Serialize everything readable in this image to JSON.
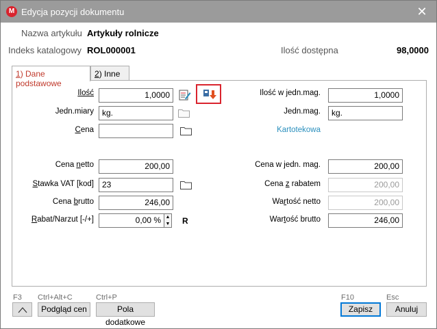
{
  "window": {
    "title": "Edycja pozycji dokumentu",
    "app_icon": "M"
  },
  "header": {
    "name_label": "Nazwa artykułu",
    "name_value": "Artykuły rolnicze",
    "index_label": "Indeks katalogowy",
    "index_value": "ROL000001",
    "qty_label": "Ilość dostępna",
    "qty_value": "98,0000"
  },
  "tabs": [
    {
      "key": "1",
      "label": ") Dane podstawowe"
    },
    {
      "key": "2",
      "label": ") Inne"
    }
  ],
  "left": {
    "qty_label": "Ilość",
    "qty_value": "1,0000",
    "unit_label": "Jedn.miary",
    "unit_value": "kg.",
    "price_label_u": "C",
    "price_label_rest": "ena",
    "price_value": "",
    "net_label_pre": "Cena ",
    "net_label_u": "n",
    "net_label_rest": "etto",
    "net_value": "200,00",
    "vat_label_u": "S",
    "vat_label_rest": "tawka VAT [kod]",
    "vat_value": "23",
    "gross_label_pre": "Cena ",
    "gross_label_u": "b",
    "gross_label_rest": "rutto",
    "gross_value": "246,00",
    "discount_label_u": "R",
    "discount_label_rest": "abat/Narzut [-/+]",
    "discount_value": "0,00 %",
    "discount_mode": "R"
  },
  "right": {
    "qty_unit_label": "Ilość w jedn.mag.",
    "qty_unit_value": "1,0000",
    "unit_label": "Jedn.mag.",
    "unit_value": "kg.",
    "price_source": "Kartotekowa",
    "unit_price_label": "Cena w jedn. mag.",
    "unit_price_value": "200,00",
    "discounted_label_pre": "Cena ",
    "discounted_label_u": "z",
    "discounted_label_rest": " rabatem",
    "discounted_value": "200,00",
    "net_value_label_pre": "Wa",
    "net_value_label_u": "r",
    "net_value_label_rest": "tość netto",
    "net_value": "200,00",
    "gross_value_label_pre": "War",
    "gross_value_label_u": "t",
    "gross_value_label_rest": "ość brutto",
    "gross_value": "246,00"
  },
  "footer": {
    "f3_hotkey": "F3",
    "preview_hotkey": "Ctrl+Alt+C",
    "preview_label": "Podgląd cen",
    "extra_hotkey": "Ctrl+P",
    "extra_label": "Pola dodatkowe",
    "save_hotkey": "F10",
    "save_label": "Zapisz",
    "cancel_hotkey": "Esc",
    "cancel_label": "Anuluj"
  },
  "colors": {
    "accent_red": "#d9232d",
    "link_blue": "#2a8fbd",
    "focus_blue": "#0078d7"
  },
  "icons": {
    "edit": "edit-list-icon",
    "folder": "folder-icon",
    "stock": "stock-arrow-icon"
  }
}
